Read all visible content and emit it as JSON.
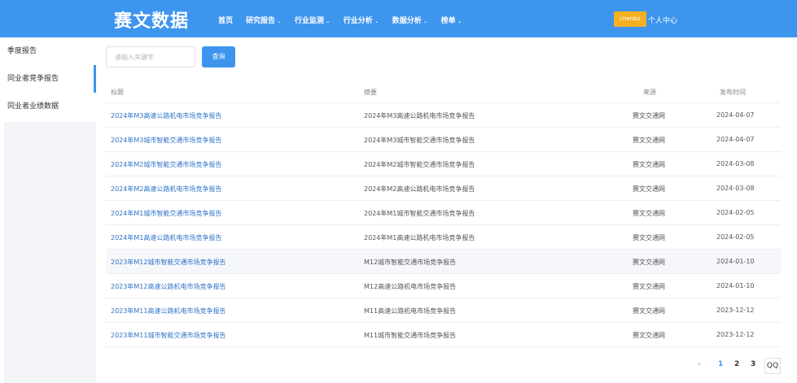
{
  "header": {
    "logo": "赛文数据",
    "nav": [
      {
        "label": "首页",
        "dropdown": false
      },
      {
        "label": "研究报告",
        "dropdown": true
      },
      {
        "label": "行业监测",
        "dropdown": true
      },
      {
        "label": "行业分析",
        "dropdown": true
      },
      {
        "label": "数据分析",
        "dropdown": true
      },
      {
        "label": "榜单",
        "dropdown": true
      }
    ],
    "caret": "⌄",
    "user_badge": "chenbo",
    "user_center": "个人中心"
  },
  "sidebar": {
    "items": [
      {
        "label": "季度报告"
      },
      {
        "label": "同业者竞争报告"
      },
      {
        "label": "同业者业绩数据"
      }
    ]
  },
  "search": {
    "placeholder": "请输入关键字",
    "button_label": "查询"
  },
  "table": {
    "headers": [
      "标题",
      "摘要",
      "来源",
      "发布时间"
    ],
    "rows": [
      {
        "title": "2024年M3高速公路机电市场竞争报告",
        "summary": "2024年M3高速公路机电市场竞争报告",
        "source": "赛文交通网",
        "date": "2024-04-07"
      },
      {
        "title": "2024年M3城市智能交通市场竞争报告",
        "summary": "2024年M3城市智能交通市场竞争报告",
        "source": "赛文交通网",
        "date": "2024-04-07"
      },
      {
        "title": "2024年M2城市智能交通市场竞争报告",
        "summary": "2024年M2城市智能交通市场竞争报告",
        "source": "赛文交通网",
        "date": "2024-03-08"
      },
      {
        "title": "2024年M2高速公路机电市场竞争报告",
        "summary": "2024年M2高速公路机电市场竞争报告",
        "source": "赛文交通网",
        "date": "2024-03-08"
      },
      {
        "title": "2024年M1城市智能交通市场竞争报告",
        "summary": "2024年M1城市智能交通市场竞争报告",
        "source": "赛文交通网",
        "date": "2024-02-05"
      },
      {
        "title": "2024年M1高速公路机电市场竞争报告",
        "summary": "2024年M1高速公路机电市场竞争报告",
        "source": "赛文交通网",
        "date": "2024-02-05"
      },
      {
        "title": "2023年M12城市智能交通市场竞争报告",
        "summary": "M12城市智能交通市场竞争报告",
        "source": "赛文交通网",
        "date": "2024-01-10"
      },
      {
        "title": "2023年M12高速公路机电市场竞争报告",
        "summary": "M12高速公路机电市场竞争报告",
        "source": "赛文交通网",
        "date": "2024-01-10"
      },
      {
        "title": "2023年M11高速公路机电市场竞争报告",
        "summary": "M11高速公路机电市场竞争报告",
        "source": "赛文交通网",
        "date": "2023-12-12"
      },
      {
        "title": "2023年M11城市智能交通市场竞争报告",
        "summary": "M11城市智能交通市场竞争报告",
        "source": "赛文交通网",
        "date": "2023-12-12"
      }
    ]
  },
  "pagination": {
    "prev": "‹",
    "pages": [
      "1",
      "2",
      "3"
    ],
    "current_page": "1",
    "jump": "QQ"
  },
  "colors": {
    "brand": "#3d95ee",
    "link": "#2f73c8",
    "badge": "#f5b022"
  }
}
